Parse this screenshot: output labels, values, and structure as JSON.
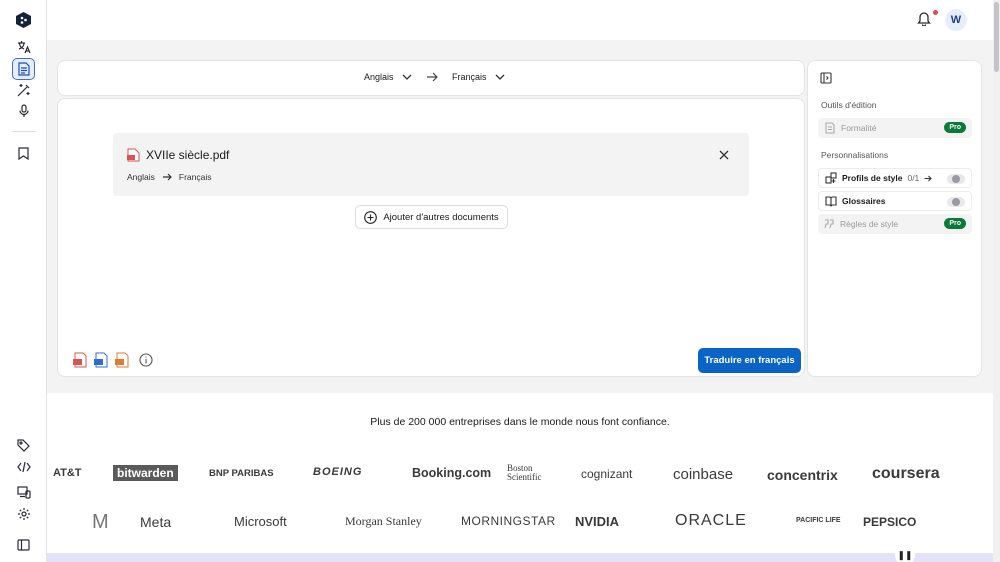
{
  "topbar": {
    "avatar_initial": "W"
  },
  "lang_bar": {
    "source": "Anglais",
    "target": "Français"
  },
  "file": {
    "name": "XVIIe siècle.pdf",
    "source": "Anglais",
    "target": "Français"
  },
  "add_docs_label": "Ajouter d'autres documents",
  "translate_label": "Traduire en français",
  "right_panel": {
    "edit_tools_heading": "Outils d'édition",
    "formality_label": "Formalité",
    "personalization_heading": "Personnalisations",
    "style_profiles_label": "Profils de style",
    "style_profiles_count": "0/1",
    "glossaries_label": "Glossaires",
    "style_rules_label": "Règles de style",
    "pro_badge": "Pro"
  },
  "trust_text": "Plus de 200 000 entreprises dans le monde nous font confiance.",
  "logos_row1": [
    "AT&T",
    "bitwarden",
    "BNP PARIBAS",
    "BOEING",
    "Booking.com",
    "Boston Scientific",
    "cognizant",
    "coinbase",
    "concentrix",
    "coursera"
  ],
  "logos_row2": [
    "Meta",
    "Microsoft",
    "Morgan Stanley",
    "MORNINGSTAR",
    "NVIDIA",
    "ORACLE",
    "PACIFIC LIFE",
    "PEPSICO"
  ],
  "colors": {
    "primary": "#0a64c6",
    "pro_badge": "#0a7a3b",
    "notification_dot": "#e5484d"
  }
}
